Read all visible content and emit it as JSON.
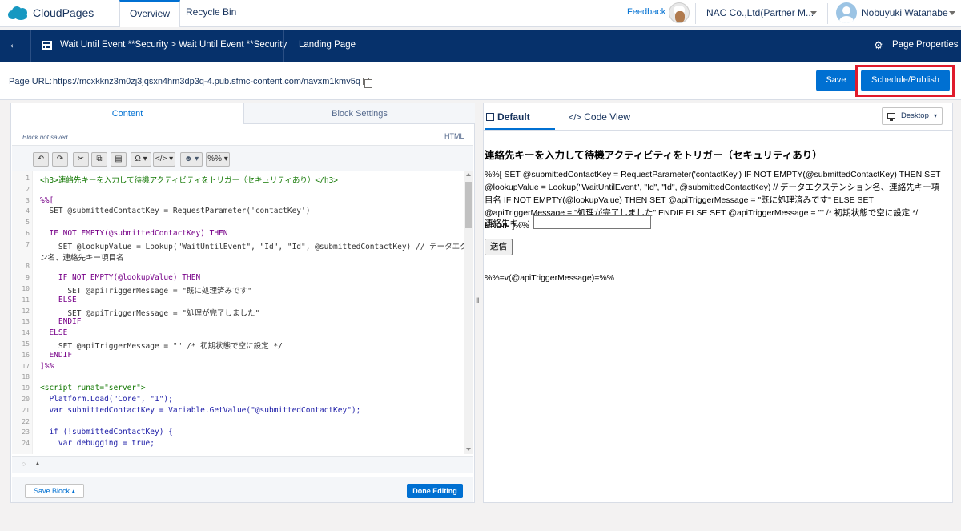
{
  "app": {
    "brand": "CloudPages"
  },
  "top_tabs": [
    {
      "label": "Overview"
    },
    {
      "label": "Recycle Bin"
    }
  ],
  "topbar": {
    "feedback": "Feedback",
    "org": "NAC Co.,Ltd(Partner M...",
    "user": "Nobuyuki Watanabe"
  },
  "navbar": {
    "breadcrumb": "Wait Until Event **Security > Wait Until Event **Security",
    "page_type": "Landing Page",
    "page_properties": "Page Properties"
  },
  "urlbar": {
    "label": "Page URL:",
    "url": "https://mcxkknz3m0zj3jqsxn4hm3dp3q-4.pub.sfmc-content.com/navxm1kmv5q",
    "save": "Save",
    "publish": "Schedule/Publish"
  },
  "editor": {
    "tab_content": "Content",
    "tab_block_settings": "Block Settings",
    "not_saved": "Block not saved",
    "mode": "HTML",
    "toolbar": {
      "omega": "Ω",
      "code": "</>",
      "person": "",
      "percent": "%%"
    },
    "lines": [
      {
        "n": "1",
        "t": "<h3>連絡先キーを入力して待機アクティビティをトリガー（セキュリティあり）</h3>"
      },
      {
        "n": "2",
        "t": ""
      },
      {
        "n": "3",
        "t": "%%["
      },
      {
        "n": "4",
        "t": "  SET @submittedContactKey = RequestParameter('contactKey')"
      },
      {
        "n": "5",
        "t": ""
      },
      {
        "n": "6",
        "t": "  IF NOT EMPTY(@submittedContactKey) THEN"
      },
      {
        "n": "7",
        "t": "    SET @lookupValue = Lookup(\"WaitUntilEvent\", \"Id\", \"Id\", @submittedContactKey) // データエクステンショ"
      },
      {
        "n": "",
        "t": "ン名、連絡先キー項目名"
      },
      {
        "n": "8",
        "t": ""
      },
      {
        "n": "9",
        "t": "    IF NOT EMPTY(@lookupValue) THEN"
      },
      {
        "n": "10",
        "t": "      SET @apiTriggerMessage = \"既に処理済みです\""
      },
      {
        "n": "11",
        "t": "    ELSE"
      },
      {
        "n": "12",
        "t": "      SET @apiTriggerMessage = \"処理が完了しました\""
      },
      {
        "n": "13",
        "t": "    ENDIF"
      },
      {
        "n": "14",
        "t": "  ELSE"
      },
      {
        "n": "15",
        "t": "    SET @apiTriggerMessage = \"\" /* 初期状態で空に設定 */"
      },
      {
        "n": "16",
        "t": "  ENDIF"
      },
      {
        "n": "17",
        "t": "]%%"
      },
      {
        "n": "18",
        "t": ""
      },
      {
        "n": "19",
        "t": "<script runat=\"server\">"
      },
      {
        "n": "20",
        "t": "  Platform.Load(\"Core\", \"1\");"
      },
      {
        "n": "21",
        "t": "  var submittedContactKey = Variable.GetValue(\"@submittedContactKey\");"
      },
      {
        "n": "22",
        "t": ""
      },
      {
        "n": "23",
        "t": "  if (!submittedContactKey) {"
      },
      {
        "n": "24",
        "t": "    var debugging = true;"
      }
    ],
    "save_block": "Save Block ▴",
    "done_editing": "Done Editing"
  },
  "preview": {
    "tab_default": "Default",
    "tab_code_view": "Code View",
    "device": "Desktop",
    "title": "連絡先キーを入力して待機アクティビティをトリガー（セキュリティあり）",
    "ampscript_text": "%%[ SET @submittedContactKey = RequestParameter('contactKey') IF NOT EMPTY(@submittedContactKey) THEN SET @lookupValue = Lookup(\"WaitUntilEvent\", \"Id\", \"Id\", @submittedContactKey) // データエクステンション名、連絡先キー項目名 IF NOT EMPTY(@lookupValue) THEN SET @apiTriggerMessage = \"既に処理済みです\" ELSE SET @apiTriggerMessage = \"処理が完了しました\" ENDIF ELSE SET @apiTriggerMessage = \"\" /* 初期状態で空に設定 */ ENDIF ]%%",
    "field_label": "連絡先キー：",
    "submit": "送信",
    "expression": "%%=v(@apiTriggerMessage)=%%"
  },
  "colors": {
    "accent": "#0070d2",
    "navbar": "#06316b",
    "highlight_frame": "#e01b2c"
  }
}
